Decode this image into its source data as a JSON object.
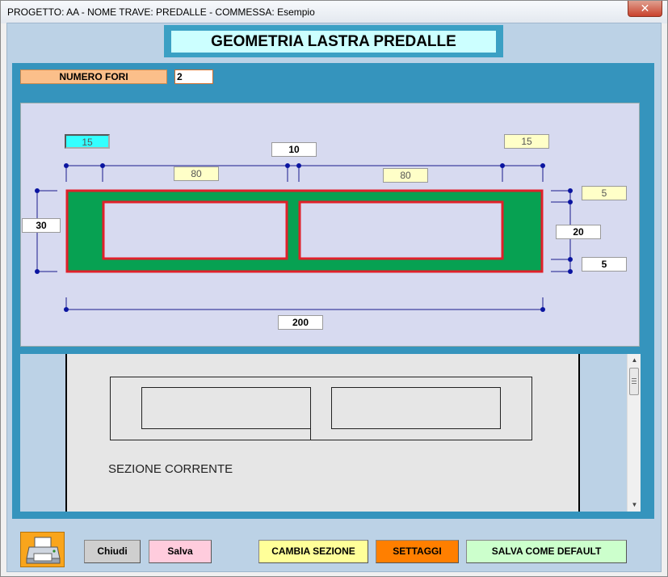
{
  "window": {
    "title": "PROGETTO: AA - NOME TRAVE: PREDALLE - COMMESSA: Esempio",
    "close_label": "✕"
  },
  "header": {
    "title": "GEOMETRIA LASTRA PREDALLE"
  },
  "numero_fori": {
    "label": "NUMERO FORI",
    "value": "2"
  },
  "dimensions": {
    "edge_left": "15",
    "gap_center": "10",
    "edge_right": "15",
    "hole1_width": "80",
    "hole2_width": "80",
    "height_total": "30",
    "top_slab": "5",
    "hole_height": "20",
    "bottom_slab": "5",
    "width_total": "200"
  },
  "preview": {
    "caption": "SEZIONE CORRENTE"
  },
  "scrollbar": {
    "up_icon": "▲",
    "down_icon": "▼"
  },
  "buttons": {
    "chiudi": "Chiudi",
    "salva": "Salva",
    "cambia_sezione": "CAMBIA SEZIONE",
    "settaggi": "SETTAGGI",
    "salva_default": "SALVA COME DEFAULT"
  },
  "colors": {
    "slab_fill": "#07a152",
    "outline": "#e0202a",
    "hole_fill": "#d7daf0",
    "dim_line": "#1a1a8c",
    "panel": "#3594bd"
  }
}
